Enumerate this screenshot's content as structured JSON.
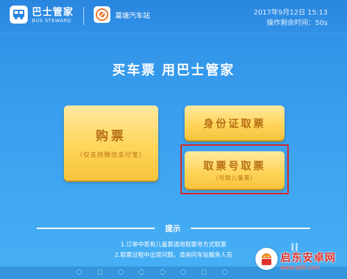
{
  "header": {
    "brand_name": "巴士管家",
    "brand_sub": "BUS STEWARD",
    "station_name": "葛塘汽车站",
    "datetime": "2017年9月12日  15:13",
    "countdown_label": "操作剩余时间：",
    "countdown_value": "50s"
  },
  "main": {
    "slogan": "买车票 用巴士管家",
    "buy": {
      "label": "购票",
      "sub": "（仅支持微信支付宝）"
    },
    "id_pickup": {
      "label": "身份证取票"
    },
    "code_pickup": {
      "label": "取票号取票",
      "sub": "（可取儿童票）"
    }
  },
  "tips": {
    "title": "提示",
    "items": [
      "1.订单中若有儿童票请用取票号方式取票",
      "2.取票过程中出现问题，请询问车站服务人员"
    ]
  },
  "watermark": {
    "text": "启东安卓网",
    "url": "www.qdlt.com"
  },
  "colors": {
    "background": "#3aa0ef",
    "button": "#ffd55a",
    "button_text": "#b76f14",
    "highlight": "#d8241f",
    "watermark": "#e1322b"
  }
}
